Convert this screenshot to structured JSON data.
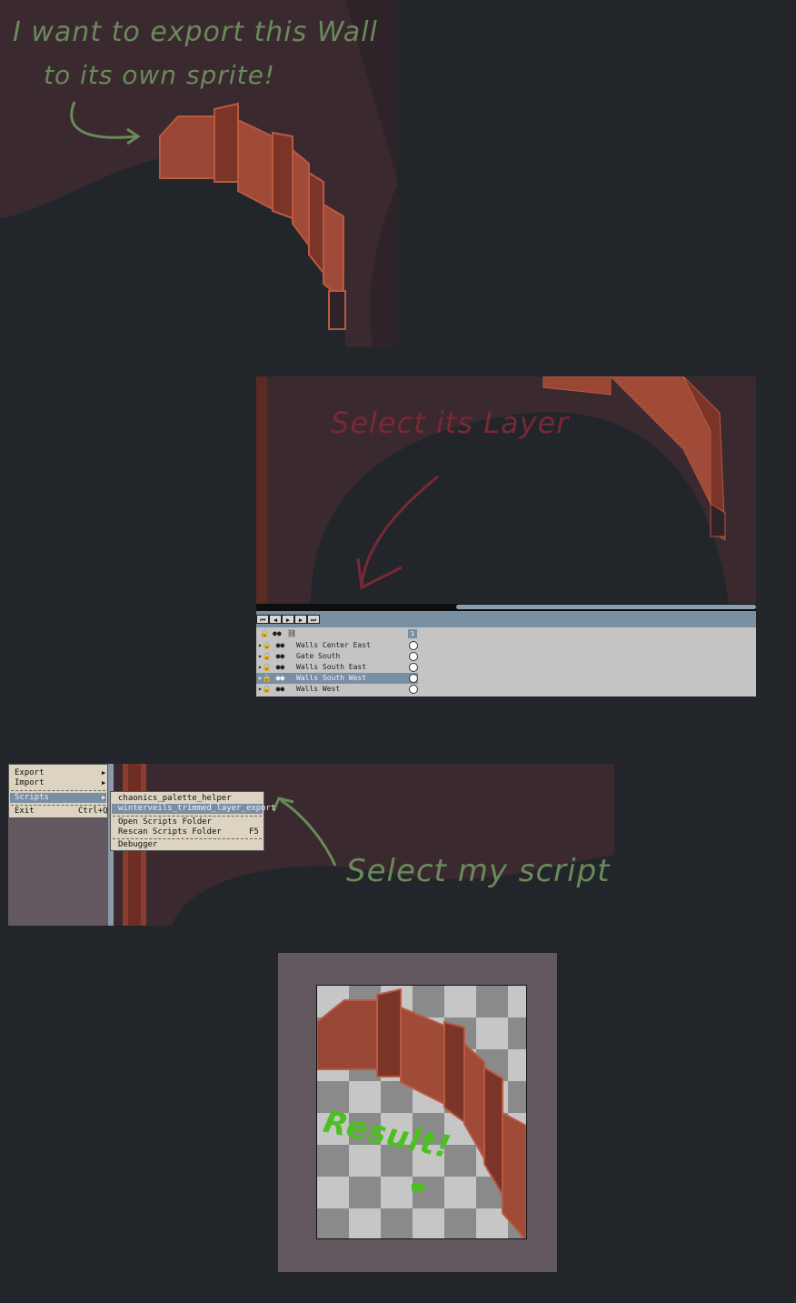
{
  "annotations": {
    "note1_line1": "I want to export this Wall",
    "note1_line2": "to its own sprite!",
    "note2": "Select its Layer",
    "note3": "Select my script",
    "note4": "Result!"
  },
  "layers_panel": {
    "frame_number": "1",
    "rows": [
      {
        "name": "Walls Center East",
        "selected": false
      },
      {
        "name": "Gate South",
        "selected": false
      },
      {
        "name": "Walls South East",
        "selected": false
      },
      {
        "name": "Walls South West",
        "selected": true
      },
      {
        "name": "Walls West",
        "selected": false
      }
    ]
  },
  "file_menu": {
    "export": "Export",
    "import": "Import",
    "scripts": "Scripts",
    "exit": "Exit",
    "exit_shortcut": "Ctrl+Q"
  },
  "scripts_menu": {
    "item1": "chaonics_palette_helper",
    "item2": "winterveils_trimmed_layer_export",
    "open_folder": "Open Scripts Folder",
    "rescan": "Rescan Scripts Folder",
    "rescan_shortcut": "F5",
    "debugger": "Debugger"
  },
  "colors": {
    "background": "#22262a",
    "canvas_dark": "#3a2a30",
    "wall_brick": "#a04a38",
    "note_green": "#6a8a5a",
    "note_red": "#7a2836",
    "result_green": "#4cc020",
    "selection": "#7990a2",
    "menu_bg": "#dcd3c0"
  }
}
